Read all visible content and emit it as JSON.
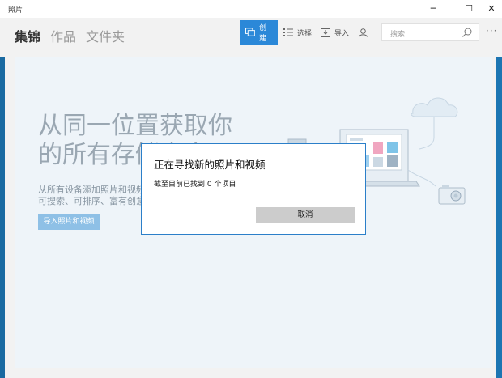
{
  "window": {
    "title": "照片"
  },
  "window_controls": {
    "minimize": "─",
    "maximize": "☐",
    "close": "✕"
  },
  "nav": {
    "tabs": [
      {
        "label": "集锦",
        "active": true
      },
      {
        "label": "作品",
        "active": false
      },
      {
        "label": "文件夹",
        "active": false
      }
    ]
  },
  "toolbar": {
    "create": "创建",
    "select": "选择",
    "import": "导入",
    "more": "···"
  },
  "search": {
    "placeholder": "搜索"
  },
  "hero": {
    "line1": "从同一位置获取你",
    "line2": "的所有存储内容",
    "desc1": "从所有设备添加照片和视频，",
    "desc2": "可搜索、可排序、富有创意",
    "button": "导入照片和视频"
  },
  "dialog": {
    "title": "正在寻找新的照片和视频",
    "message": "截至目前已找到 0 个项目",
    "cancel": "取消"
  },
  "colors": {
    "accent": "#2b88d8",
    "taskbar_edge": "#1b6fa8",
    "dialog_border": "#2b7fc9"
  }
}
